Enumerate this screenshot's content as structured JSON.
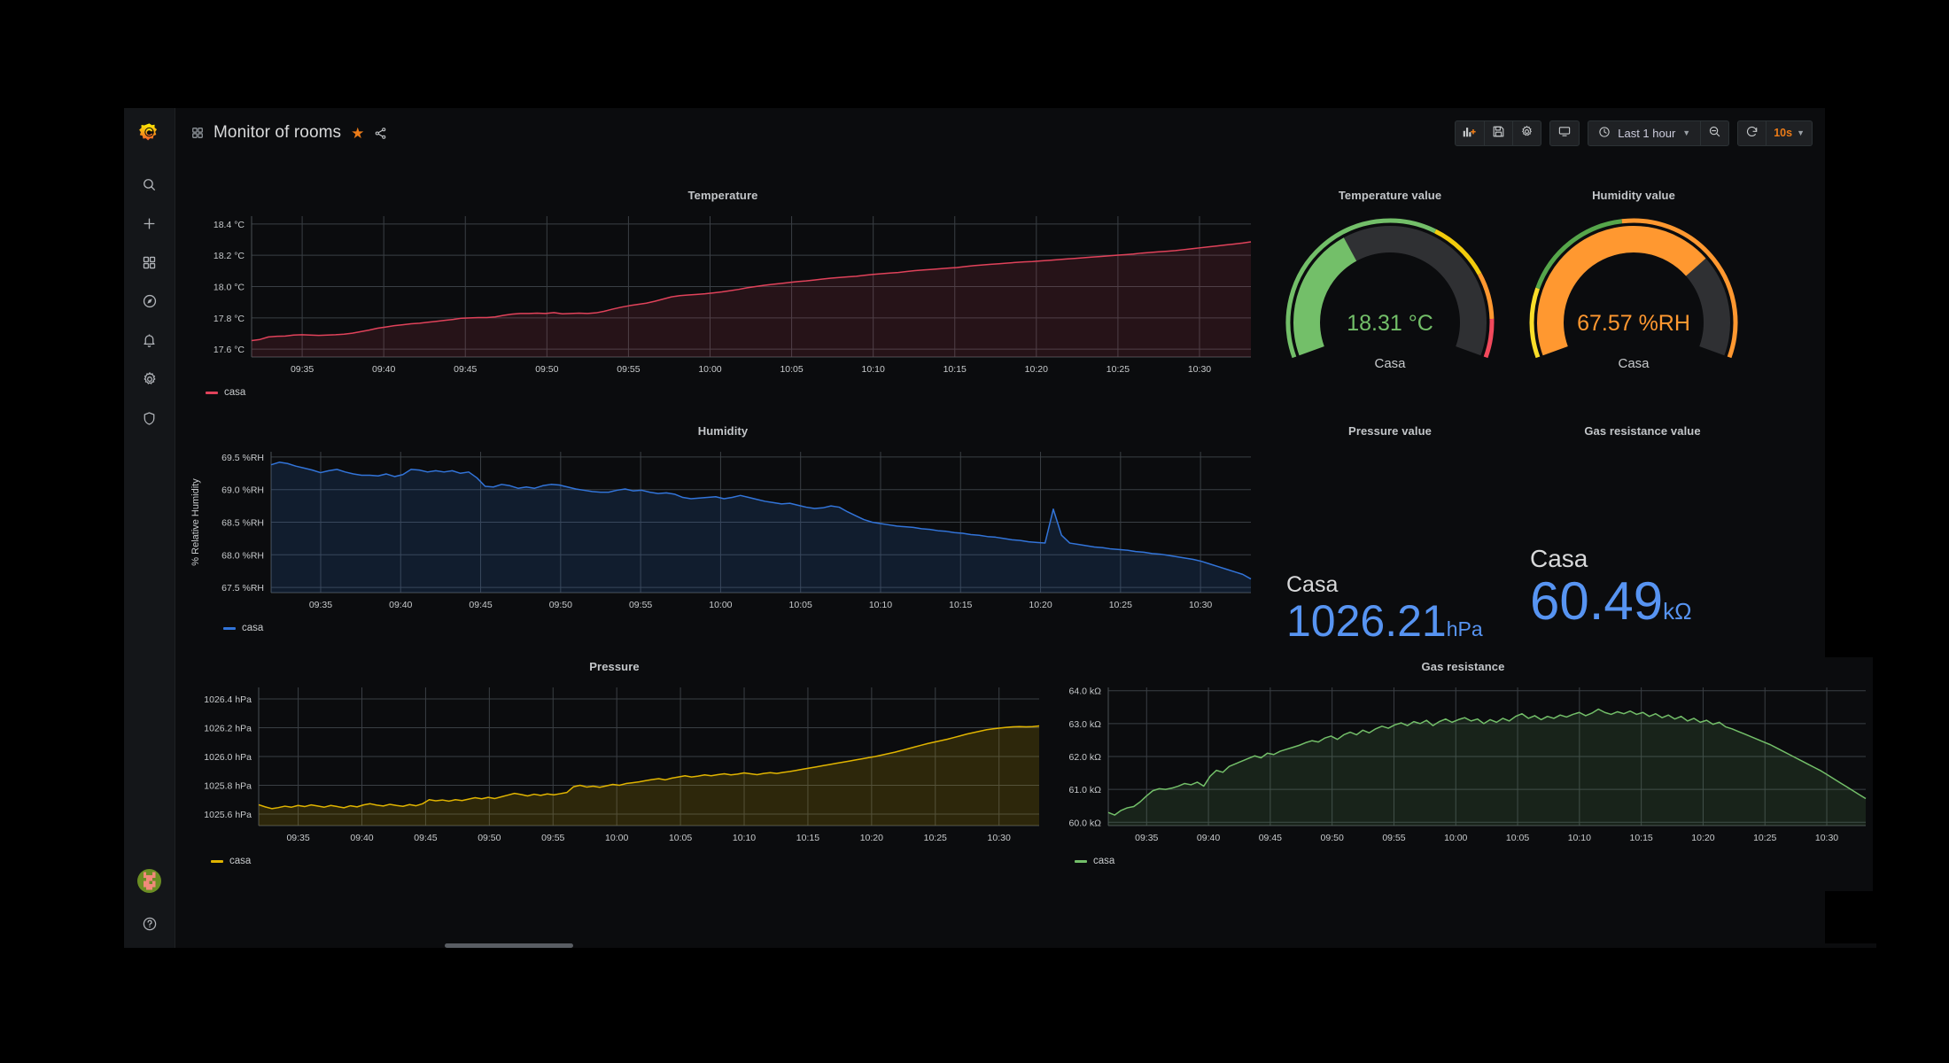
{
  "app": {
    "background": "#0b0c0e",
    "sidebar_bg": "#141619"
  },
  "sidebar": {
    "brand_icon": "grafana-logo-icon",
    "items": [
      {
        "icon": "search-icon",
        "label": "Search"
      },
      {
        "icon": "plus-icon",
        "label": "Create"
      },
      {
        "icon": "dashboards-icon",
        "label": "Dashboards"
      },
      {
        "icon": "compass-icon",
        "label": "Explore"
      },
      {
        "icon": "bell-icon",
        "label": "Alerting"
      },
      {
        "icon": "gear-icon",
        "label": "Configuration"
      },
      {
        "icon": "shield-icon",
        "label": "Server Admin"
      }
    ],
    "avatar": {
      "icon": "avatar",
      "label": "User profile"
    },
    "help": {
      "icon": "help-icon",
      "label": "Help"
    }
  },
  "topnav": {
    "dashboard_icon": "dashboard-grid-icon",
    "title": "Monitor of rooms",
    "star_icon": "star-icon",
    "share_icon": "share-icon",
    "buttons": [
      {
        "icon": "add-panel-icon",
        "label": "Add panel"
      },
      {
        "icon": "save-icon",
        "label": "Save dashboard"
      },
      {
        "icon": "gear-icon",
        "label": "Dashboard settings"
      },
      {
        "icon": "tv-icon",
        "label": "Cycle view mode"
      }
    ],
    "time_picker": {
      "icon": "clock-icon",
      "value": "Last 1 hour",
      "caret": "chevron-down-icon"
    },
    "zoom_out": {
      "icon": "zoom-out-icon",
      "label": "Zoom out time range"
    },
    "refresh": {
      "icon": "refresh-icon",
      "label": "Refresh dashboard"
    },
    "refresh_interval": {
      "value": "10s",
      "caret": "chevron-down-icon"
    }
  },
  "panels": {
    "temperature": {
      "title": "Temperature"
    },
    "humidity": {
      "title": "Humidity"
    },
    "pressure": {
      "title": "Pressure"
    },
    "gas": {
      "title": "Gas resistance"
    },
    "temp_gauge": {
      "title": "Temperature value"
    },
    "hum_gauge": {
      "title": "Humidity value"
    },
    "pressure_stat": {
      "title": "Pressure value"
    },
    "gas_stat": {
      "title": "Gas resistance value"
    }
  },
  "gauges": {
    "temperature": {
      "value_text": "18.31 °C",
      "value": 18.31,
      "name": "Casa",
      "fill_fraction": 0.37,
      "value_color": "#73bf69",
      "thresholds": [
        {
          "color": "#73bf69",
          "from": 0.0
        },
        {
          "color": "#f2cc0c",
          "from": 0.62
        },
        {
          "color": "#ff9830",
          "from": 0.78
        },
        {
          "color": "#f2495c",
          "from": 0.9
        }
      ]
    },
    "humidity": {
      "value_text": "67.57 %RH",
      "value": 67.57,
      "name": "Casa",
      "fill_fraction": 0.72,
      "value_color": "#ff9830",
      "thresholds": [
        {
          "color": "#fade2a",
          "from": 0.0
        },
        {
          "color": "#56a64b",
          "from": 0.18
        },
        {
          "color": "#ff9830",
          "from": 0.47
        }
      ]
    }
  },
  "stats": {
    "pressure": {
      "series_name": "Casa",
      "value": "1026.21",
      "unit": "hPa",
      "color": "#5794f2"
    },
    "gas": {
      "series_name": "Casa",
      "value": "60.49",
      "unit": "kΩ",
      "color": "#5794f2"
    }
  },
  "chart_data": [
    {
      "type": "line",
      "title": "Temperature",
      "xlabel": "",
      "ylabel": "",
      "legend": [
        "casa"
      ],
      "legend_position": "bottom-left",
      "series_color": "#e0425a",
      "grid": true,
      "xticks": [
        "09:35",
        "09:40",
        "09:45",
        "09:50",
        "09:55",
        "10:00",
        "10:05",
        "10:10",
        "10:15",
        "10:20",
        "10:25",
        "10:30"
      ],
      "yticks": [
        "17.6 °C",
        "17.8 °C",
        "18.0 °C",
        "18.2 °C",
        "18.4 °C"
      ],
      "ylim": [
        17.55,
        18.45
      ],
      "series": [
        {
          "name": "casa",
          "values": [
            17.655,
            17.662,
            17.678,
            17.682,
            17.684,
            17.69,
            17.692,
            17.69,
            17.688,
            17.69,
            17.692,
            17.696,
            17.702,
            17.712,
            17.722,
            17.734,
            17.742,
            17.75,
            17.756,
            17.762,
            17.766,
            17.772,
            17.778,
            17.784,
            17.79,
            17.798,
            17.8,
            17.802,
            17.802,
            17.806,
            17.816,
            17.824,
            17.828,
            17.828,
            17.83,
            17.828,
            17.834,
            17.826,
            17.828,
            17.83,
            17.828,
            17.832,
            17.842,
            17.856,
            17.868,
            17.878,
            17.886,
            17.894,
            17.906,
            17.92,
            17.934,
            17.942,
            17.946,
            17.95,
            17.954,
            17.96,
            17.966,
            17.974,
            17.982,
            17.992,
            18.0,
            18.008,
            18.014,
            18.02,
            18.026,
            18.032,
            18.036,
            18.042,
            18.048,
            18.054,
            18.058,
            18.062,
            18.066,
            18.072,
            18.078,
            18.082,
            18.086,
            18.09,
            18.096,
            18.102,
            18.106,
            18.11,
            18.114,
            18.118,
            18.122,
            18.128,
            18.134,
            18.138,
            18.142,
            18.146,
            18.15,
            18.154,
            18.158,
            18.16,
            18.164,
            18.168,
            18.172,
            18.176,
            18.18,
            18.184,
            18.188,
            18.192,
            18.196,
            18.2,
            18.204,
            18.208,
            18.214,
            18.218,
            18.222,
            18.226,
            18.23,
            18.236,
            18.242,
            18.248,
            18.254,
            18.26,
            18.266,
            18.272,
            18.278,
            18.286
          ]
        }
      ]
    },
    {
      "type": "line",
      "title": "Humidity",
      "xlabel": "",
      "ylabel": "% Relative Humidity",
      "legend": [
        "casa"
      ],
      "legend_position": "bottom-left",
      "series_color": "#3274d9",
      "grid": true,
      "xticks": [
        "09:35",
        "09:40",
        "09:45",
        "09:50",
        "09:55",
        "10:00",
        "10:05",
        "10:10",
        "10:15",
        "10:20",
        "10:25",
        "10:30"
      ],
      "yticks": [
        "67.5 %RH",
        "68.0 %RH",
        "68.5 %RH",
        "69.0 %RH",
        "69.5 %RH"
      ],
      "ylim": [
        67.42,
        69.58
      ],
      "series": [
        {
          "name": "casa",
          "values": [
            69.38,
            69.42,
            69.4,
            69.36,
            69.33,
            69.3,
            69.26,
            69.29,
            69.31,
            69.27,
            69.24,
            69.22,
            69.22,
            69.21,
            69.24,
            69.2,
            69.23,
            69.31,
            69.3,
            69.27,
            69.29,
            69.27,
            69.29,
            69.25,
            69.27,
            69.18,
            69.05,
            69.04,
            69.08,
            69.06,
            69.02,
            69.04,
            69.02,
            69.06,
            69.08,
            69.07,
            69.04,
            69.01,
            68.99,
            68.97,
            68.96,
            68.96,
            68.99,
            69.01,
            68.98,
            68.99,
            68.96,
            68.94,
            68.95,
            68.93,
            68.88,
            68.86,
            68.87,
            68.88,
            68.89,
            68.86,
            68.88,
            68.91,
            68.88,
            68.85,
            68.82,
            68.8,
            68.78,
            68.79,
            68.76,
            68.73,
            68.71,
            68.72,
            68.75,
            68.73,
            68.66,
            68.6,
            68.54,
            68.5,
            68.48,
            68.46,
            68.44,
            68.43,
            68.42,
            68.4,
            68.39,
            68.37,
            68.36,
            68.34,
            68.33,
            68.31,
            68.3,
            68.28,
            68.27,
            68.25,
            68.23,
            68.22,
            68.2,
            68.19,
            68.18,
            68.7,
            68.3,
            68.18,
            68.16,
            68.14,
            68.12,
            68.11,
            68.09,
            68.08,
            68.07,
            68.05,
            68.04,
            68.02,
            68.01,
            67.99,
            67.97,
            67.95,
            67.93,
            67.9,
            67.86,
            67.82,
            67.78,
            67.74,
            67.7,
            67.63
          ]
        }
      ]
    },
    {
      "type": "line",
      "title": "Pressure",
      "xlabel": "",
      "ylabel": "",
      "legend": [
        "casa"
      ],
      "legend_position": "bottom-left",
      "series_color": "#e0b400",
      "grid": true,
      "xticks": [
        "09:35",
        "09:40",
        "09:45",
        "09:50",
        "09:55",
        "10:00",
        "10:05",
        "10:10",
        "10:15",
        "10:20",
        "10:25",
        "10:30"
      ],
      "yticks": [
        "1025.6 hPa",
        "1025.8 hPa",
        "1026.0 hPa",
        "1026.2 hPa",
        "1026.4 hPa"
      ],
      "ylim": [
        1025.52,
        1026.48
      ],
      "series": [
        {
          "name": "casa",
          "values": [
            1025.665,
            1025.65,
            1025.638,
            1025.645,
            1025.655,
            1025.648,
            1025.66,
            1025.652,
            1025.664,
            1025.656,
            1025.648,
            1025.66,
            1025.652,
            1025.644,
            1025.658,
            1025.65,
            1025.664,
            1025.672,
            1025.662,
            1025.656,
            1025.668,
            1025.66,
            1025.654,
            1025.666,
            1025.658,
            1025.672,
            1025.7,
            1025.692,
            1025.698,
            1025.69,
            1025.7,
            1025.694,
            1025.704,
            1025.714,
            1025.706,
            1025.716,
            1025.708,
            1025.72,
            1025.732,
            1025.744,
            1025.736,
            1025.726,
            1025.738,
            1025.73,
            1025.74,
            1025.734,
            1025.742,
            1025.75,
            1025.79,
            1025.8,
            1025.788,
            1025.794,
            1025.786,
            1025.796,
            1025.806,
            1025.8,
            1025.812,
            1025.818,
            1025.824,
            1025.832,
            1025.84,
            1025.846,
            1025.838,
            1025.85,
            1025.858,
            1025.866,
            1025.858,
            1025.864,
            1025.872,
            1025.866,
            1025.874,
            1025.88,
            1025.872,
            1025.878,
            1025.886,
            1025.88,
            1025.874,
            1025.882,
            1025.888,
            1025.882,
            1025.89,
            1025.896,
            1025.904,
            1025.912,
            1025.92,
            1025.928,
            1025.936,
            1025.944,
            1025.952,
            1025.96,
            1025.968,
            1025.976,
            1025.984,
            1025.992,
            1026.0,
            1026.01,
            1026.02,
            1026.03,
            1026.042,
            1026.054,
            1026.066,
            1026.078,
            1026.09,
            1026.1,
            1026.11,
            1026.12,
            1026.132,
            1026.144,
            1026.156,
            1026.166,
            1026.176,
            1026.186,
            1026.192,
            1026.198,
            1026.202,
            1026.206,
            1026.208,
            1026.206,
            1026.208,
            1026.212
          ]
        }
      ]
    },
    {
      "type": "line",
      "title": "Gas resistance",
      "xlabel": "",
      "ylabel": "",
      "legend": [
        "casa"
      ],
      "legend_position": "bottom-left",
      "series_color": "#73bf69",
      "grid": true,
      "xticks": [
        "09:35",
        "09:40",
        "09:45",
        "09:50",
        "09:55",
        "10:00",
        "10:05",
        "10:10",
        "10:15",
        "10:20",
        "10:25",
        "10:30"
      ],
      "yticks": [
        "60.0 kΩ",
        "61.0 kΩ",
        "62.0 kΩ",
        "63.0 kΩ",
        "64.0 kΩ"
      ],
      "ylim": [
        59.9,
        64.1
      ],
      "series": [
        {
          "name": "casa",
          "values": [
            60.3,
            60.22,
            60.36,
            60.44,
            60.48,
            60.62,
            60.8,
            60.96,
            61.02,
            61.0,
            61.04,
            61.1,
            61.18,
            61.14,
            61.22,
            61.1,
            61.4,
            61.58,
            61.52,
            61.7,
            61.78,
            61.86,
            61.94,
            62.02,
            61.96,
            62.1,
            62.06,
            62.16,
            62.22,
            62.28,
            62.34,
            62.42,
            62.48,
            62.44,
            62.56,
            62.62,
            62.52,
            62.66,
            62.74,
            62.66,
            62.8,
            62.72,
            62.84,
            62.92,
            62.86,
            62.96,
            63.02,
            62.94,
            63.06,
            63.0,
            63.1,
            62.94,
            63.06,
            63.14,
            63.04,
            63.12,
            63.18,
            63.08,
            63.14,
            63.0,
            63.12,
            63.04,
            63.16,
            63.08,
            63.22,
            63.3,
            63.16,
            63.24,
            63.12,
            63.22,
            63.16,
            63.26,
            63.2,
            63.28,
            63.34,
            63.24,
            63.32,
            63.44,
            63.34,
            63.28,
            63.36,
            63.3,
            63.38,
            63.28,
            63.34,
            63.22,
            63.3,
            63.18,
            63.26,
            63.14,
            63.22,
            63.08,
            63.16,
            63.04,
            63.1,
            62.98,
            63.04,
            62.9,
            62.84,
            62.76,
            62.68,
            62.6,
            62.52,
            62.44,
            62.36,
            62.26,
            62.16,
            62.06,
            61.96,
            61.86,
            61.76,
            61.66,
            61.56,
            61.44,
            61.32,
            61.2,
            61.08,
            60.96,
            60.84,
            60.72
          ]
        }
      ]
    }
  ]
}
